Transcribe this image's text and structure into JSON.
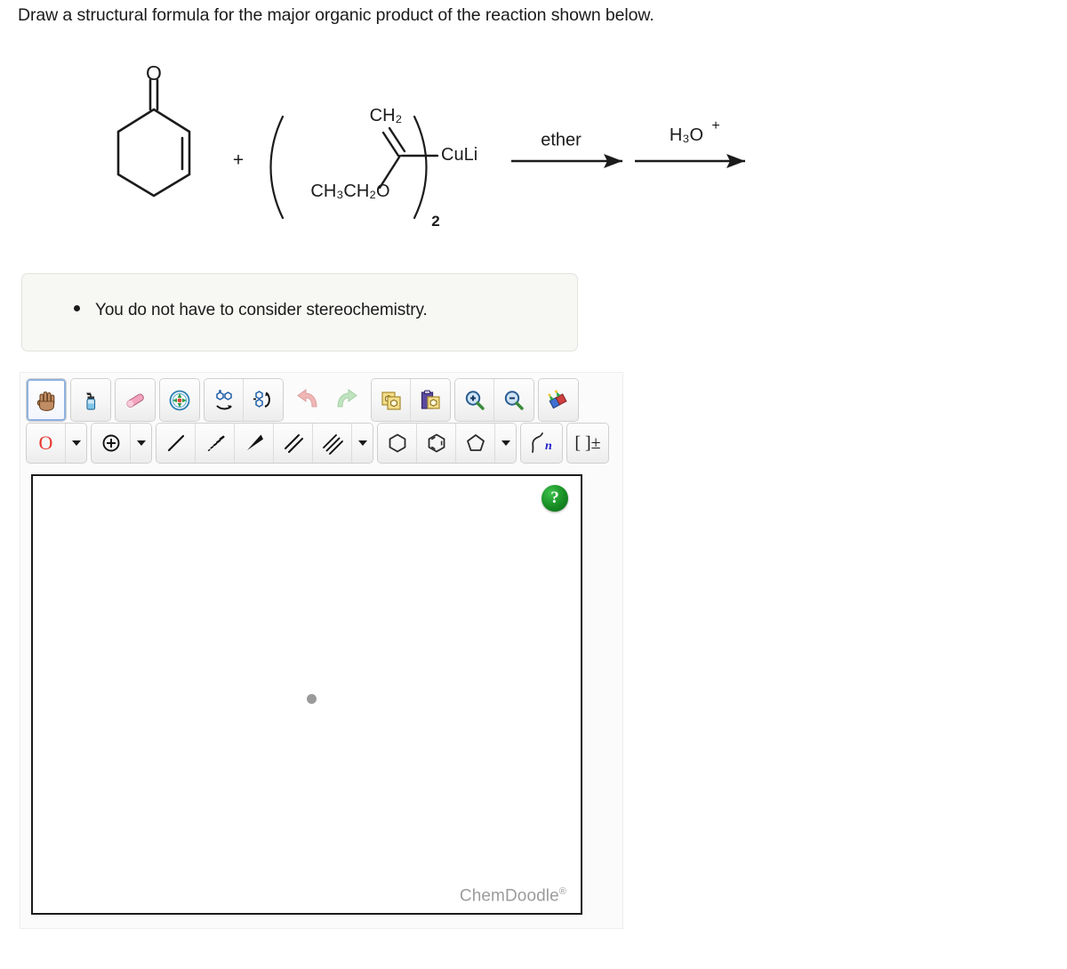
{
  "prompt": "Draw a structural formula for the major organic product of the reaction shown below.",
  "reaction": {
    "reactant1_name": "cyclohex-2-en-1-one",
    "reactant1_oxygen_label": "O",
    "plus_sign": "+",
    "reagent": {
      "top_group": "CH₂",
      "bottom_group": "CH₃CH₂O",
      "metal_label": "CuLi",
      "subscript": "2"
    },
    "arrow1_label": "ether",
    "arrow2_label_main": "H₃O",
    "arrow2_label_charge": "+"
  },
  "note": {
    "bullet_text": "You do not have to consider stereochemistry."
  },
  "sketcher": {
    "toolbar_row1": [
      {
        "name": "hand-tool",
        "icon": "hand",
        "selected": true
      },
      {
        "name": "clean-structure-tool",
        "icon": "spray-bottle",
        "selected": false
      },
      {
        "name": "eraser-tool",
        "icon": "eraser",
        "selected": false
      },
      {
        "name": "center-tool",
        "icon": "compass",
        "selected": false
      },
      {
        "name": "flip-horizontal-tool",
        "icon": "flip-h",
        "selected": false
      },
      {
        "name": "flip-vertical-tool",
        "icon": "flip-v",
        "selected": false
      },
      {
        "name": "undo-button",
        "icon": "undo-arrow",
        "selected": false
      },
      {
        "name": "redo-button",
        "icon": "redo-arrow",
        "selected": false
      },
      {
        "name": "copy-button",
        "icon": "copy",
        "selected": false
      },
      {
        "name": "paste-button",
        "icon": "paste",
        "selected": false
      },
      {
        "name": "zoom-in-button",
        "icon": "magnifier-plus",
        "selected": false
      },
      {
        "name": "zoom-out-button",
        "icon": "magnifier-minus",
        "selected": false
      },
      {
        "name": "templates-button",
        "icon": "palette",
        "selected": false
      }
    ],
    "toolbar_row2": [
      {
        "name": "atom-label-oxygen-tool",
        "icon": "atom-O",
        "label": "O"
      },
      {
        "name": "atom-label-dropdown",
        "icon": "caret-down",
        "label": ""
      },
      {
        "name": "charge-tool",
        "icon": "charge-plus",
        "label": ""
      },
      {
        "name": "charge-dropdown",
        "icon": "caret-down",
        "label": ""
      },
      {
        "name": "single-bond-tool",
        "icon": "bond-single",
        "label": ""
      },
      {
        "name": "hashed-wedge-bond-tool",
        "icon": "bond-hashed",
        "label": ""
      },
      {
        "name": "solid-wedge-bond-tool",
        "icon": "bond-wedge",
        "label": ""
      },
      {
        "name": "double-bond-tool",
        "icon": "bond-double",
        "label": ""
      },
      {
        "name": "triple-bond-tool",
        "icon": "bond-triple",
        "label": ""
      },
      {
        "name": "bond-dropdown",
        "icon": "caret-down",
        "label": ""
      },
      {
        "name": "cyclohexane-ring-tool",
        "icon": "hexagon",
        "label": ""
      },
      {
        "name": "benzene-ring-tool",
        "icon": "benzene",
        "label": ""
      },
      {
        "name": "cyclopentane-ring-tool",
        "icon": "pentagon",
        "label": ""
      },
      {
        "name": "ring-dropdown",
        "icon": "caret-down",
        "label": ""
      },
      {
        "name": "polymer-repeat-tool",
        "icon": "polymer-n",
        "label": "n"
      },
      {
        "name": "bracket-charge-tool",
        "icon": "bracket-pm",
        "label": "[ ]±"
      }
    ],
    "help_button_label": "?",
    "watermark_text": "ChemDoodle",
    "watermark_mark": "®"
  },
  "colors": {
    "oxygen_red": "#e8392f",
    "help_green": "#178c23",
    "polymer_blue": "#2222cc",
    "selection_blue": "#8fb2e0",
    "note_background": "#f7f7f4",
    "watermark_gray": "#9c9c9c"
  }
}
